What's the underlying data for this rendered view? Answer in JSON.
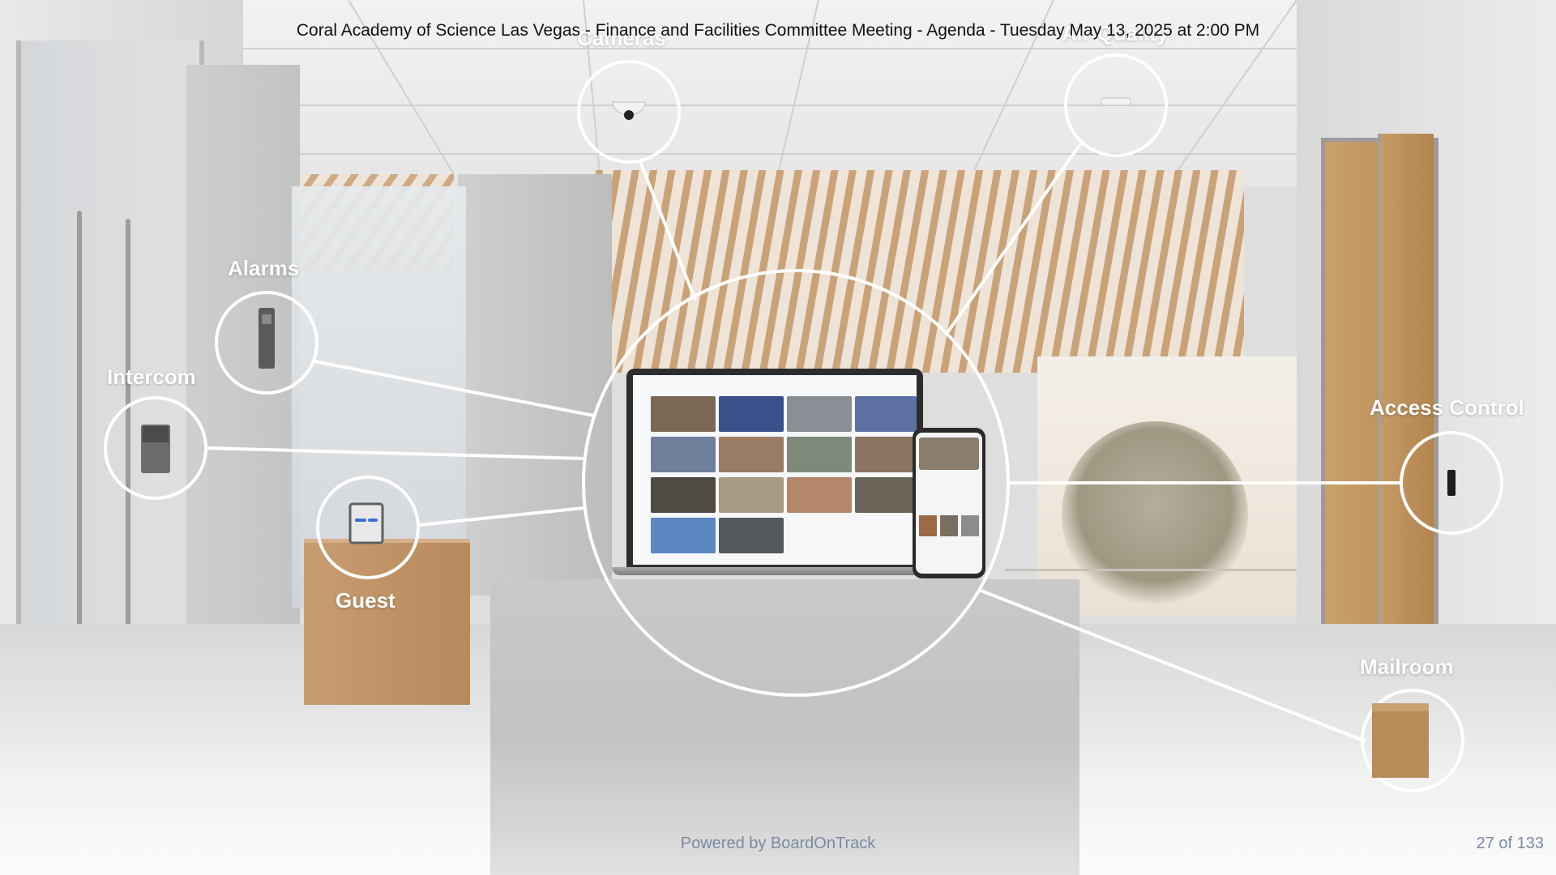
{
  "header": {
    "title": "Coral Academy of Science Las Vegas - Finance and Facilities Committee Meeting - Agenda - Tuesday May 13, 2025 at 2:00 PM"
  },
  "slide": {
    "labels": {
      "cameras": "Cameras",
      "air_quality": "Air Quality",
      "alarms": "Alarms",
      "intercom": "Intercom",
      "guest": "Guest",
      "access_control": "Access Control",
      "mailroom": "Mailroom"
    },
    "icons": {
      "cameras": "dome-camera-icon",
      "air_quality": "air-quality-sensor-icon",
      "alarms": "alarm-keypad-icon",
      "intercom": "intercom-icon",
      "guest": "guest-kiosk-icon",
      "access_control": "card-reader-icon",
      "mailroom": "package-box-icon"
    },
    "colors": {
      "ring": "#ffffff",
      "label": "#ffffff"
    }
  },
  "footer": {
    "powered_by": "Powered by BoardOnTrack",
    "page": "27 of 133"
  }
}
